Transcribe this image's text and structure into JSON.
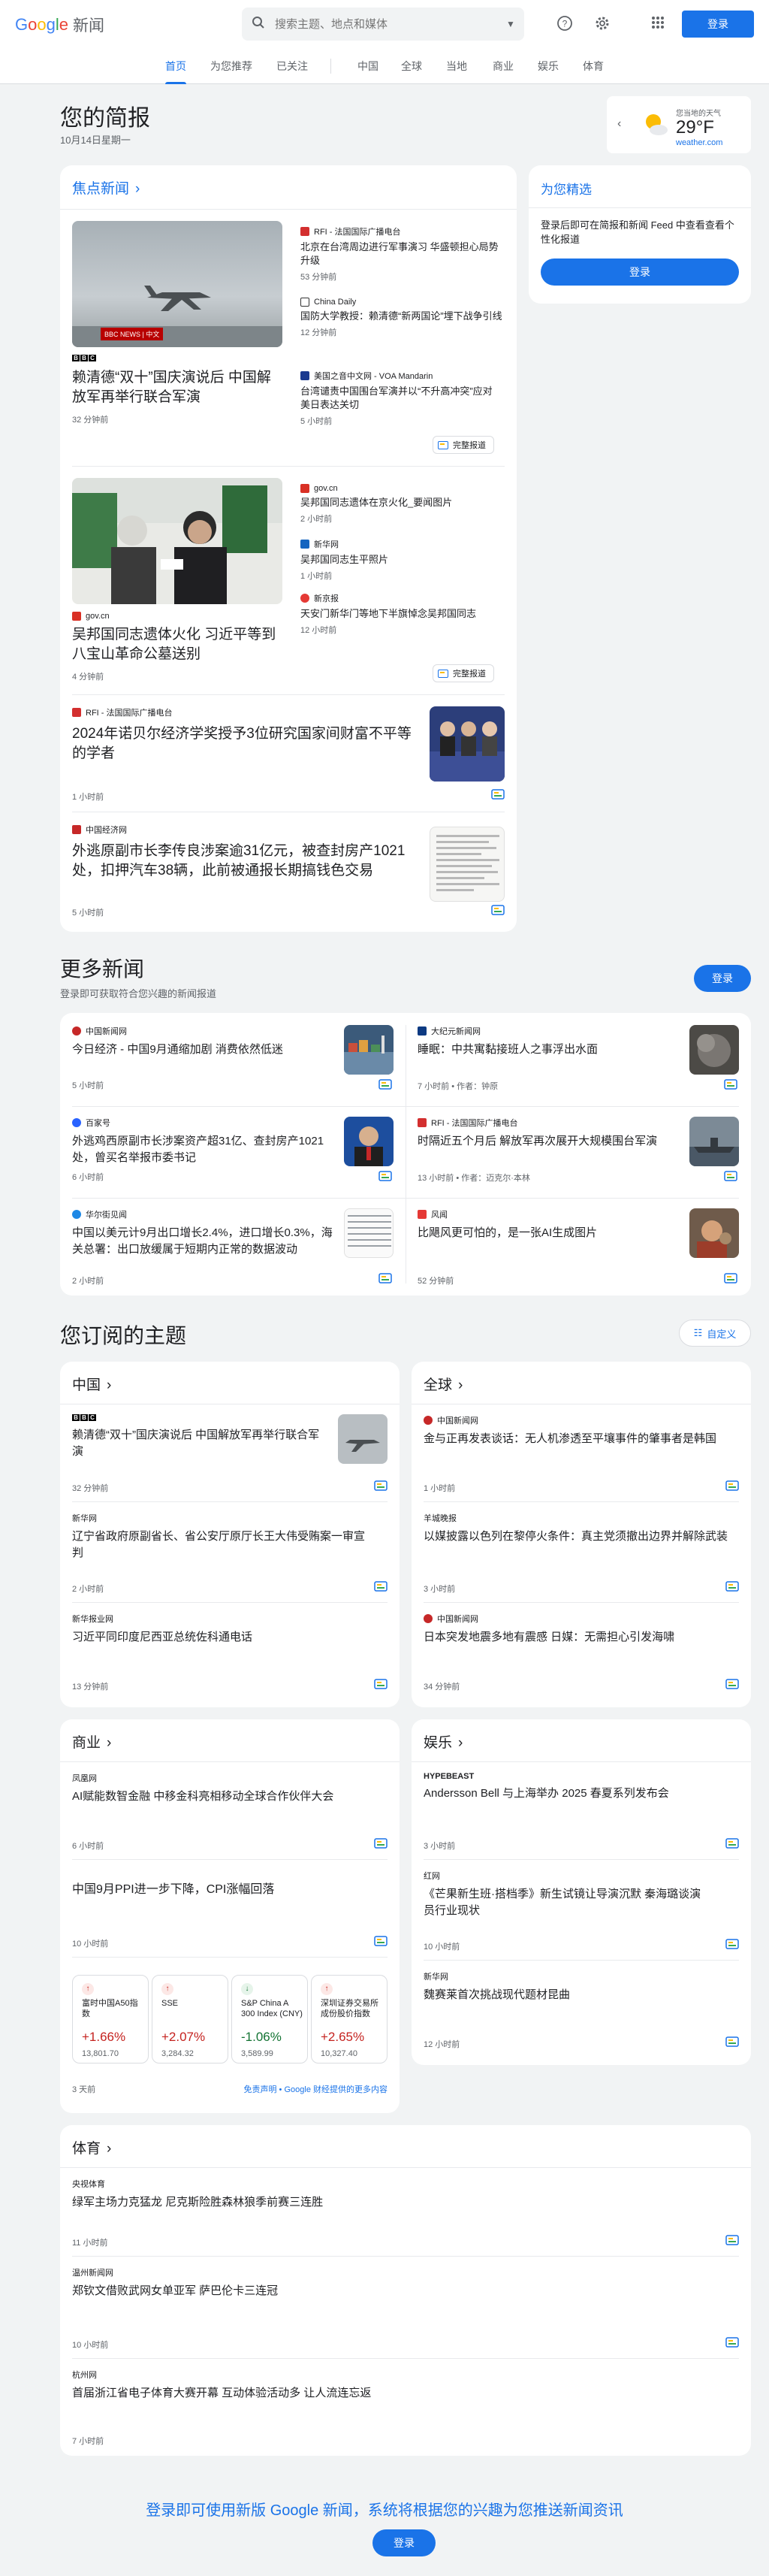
{
  "header": {
    "logo_google": [
      "G",
      "o",
      "o",
      "g",
      "l",
      "e"
    ],
    "logo_news": "新闻",
    "search_placeholder": "搜索主题、地点和媒体",
    "signin": "登录"
  },
  "nav": {
    "tabs": [
      "首页",
      "为您推荐",
      "已关注"
    ],
    "sections": [
      "中国",
      "全球",
      "当地",
      "商业",
      "娱乐",
      "体育"
    ]
  },
  "briefing": {
    "title": "您的简报",
    "date": "10月14日星期一"
  },
  "weather": {
    "location": "您当地的天气",
    "temp": "29°F",
    "source": "weather.com"
  },
  "top_stories": {
    "label": "焦点新闻",
    "cluster1": {
      "main": {
        "publisher": "BBC",
        "headline": "赖清德“双十”国庆演说后 中国解放军再举行联合军演",
        "time": "32 分钟前"
      },
      "image_tag": "BBC NEWS | 中文",
      "side": [
        {
          "publisher": "RFI - 法国国际广播电台",
          "headline": "北京在台湾周边进行军事演习 华盛顿担心局势升级",
          "time": "53 分钟前"
        },
        {
          "publisher": "China Daily",
          "headline": "国防大学教授：赖清德“新两国论”埋下战争引线",
          "time": "12 分钟前"
        },
        {
          "publisher": "美国之音中文网 - VOA Mandarin",
          "headline": "台湾谴责中国围台军演并以“不升高冲突”应对 美日表达关切",
          "time": "5 小时前"
        }
      ],
      "full_coverage": "完整报道"
    },
    "cluster2": {
      "main": {
        "publisher": "gov.cn",
        "headline": "吴邦国同志遗体火化 习近平等到八宝山革命公墓送别",
        "time": "4 分钟前"
      },
      "side": [
        {
          "publisher": "gov.cn",
          "headline": "吴邦国同志遗体在京火化_要闻图片",
          "time": "2 小时前"
        },
        {
          "publisher": "新华网",
          "headline": "吴邦国同志生平照片",
          "time": "1 小时前"
        },
        {
          "publisher": "新京报",
          "headline": "天安门新华门等地下半旗悼念吴邦国同志",
          "time": "12 小时前"
        }
      ],
      "full_coverage": "完整报道"
    },
    "story3": {
      "publisher": "RFI - 法国国际广播电台",
      "headline": "2024年诺贝尔经济学奖授予3位研究国家间财富不平等的学者",
      "time": "1 小时前"
    },
    "story4": {
      "publisher": "中国经济网",
      "headline": "外逃原副市长李传良涉案逾31亿元，被查封房产1021处，扣押汽车38辆，此前被通报长期搞钱色交易",
      "time": "5 小时前"
    }
  },
  "for_you_panel": {
    "title": "为您精选",
    "desc": "登录后即可在简报和新闻 Feed 中查看查看个性化报道",
    "button": "登录"
  },
  "more_news": {
    "title": "更多新闻",
    "subtitle": "登录即可获取符合您兴趣的新闻报道",
    "button": "登录",
    "items": [
      {
        "publisher": "中国新闻网",
        "headline": "今日经济 - 中国9月通缩加剧 消费依然低迷",
        "time": "5 小时前",
        "author": ""
      },
      {
        "publisher": "大纪元新闻网",
        "headline": "睡眠：中共寓黏接班人之事浮出水面",
        "time": "7 小时前",
        "author": "作者：钟原"
      },
      {
        "publisher": "百家号",
        "headline": "外逃鸡西原副市长涉案资产超31亿、查封房产1021处，曾买名举报市委书记",
        "time": "6 小时前",
        "author": ""
      },
      {
        "publisher": "RFI - 法国国际广播电台",
        "headline": "时隔近五个月后 解放军再次展开大规模围台军演",
        "time": "13 小时前",
        "author": "作者：迈克尔·本林"
      },
      {
        "publisher": "华尔街见闻",
        "headline": "中国以美元计9月出口增长2.4%，进口增长0.3%，海关总署：出口放缓属于短期内正常的数据波动",
        "time": "2 小时前",
        "author": ""
      },
      {
        "publisher": "风闻",
        "headline": "比飓风更可怕的，是一张AI生成图片",
        "time": "52 分钟前",
        "author": ""
      }
    ]
  },
  "topics": {
    "title": "您订阅的主题",
    "customize": "自定义",
    "china": {
      "label": "中国",
      "items": [
        {
          "publisher": "BBC",
          "headline": "赖清德“双十”国庆演说后 中国解放军再举行联合军演",
          "time": "32 分钟前"
        },
        {
          "publisher": "新华网",
          "headline": "辽宁省政府原副省长、省公安厅原厅长王大伟受贿案一审宣判",
          "time": "2 小时前"
        },
        {
          "publisher": "新华报业网",
          "headline": "习近平同印度尼西亚总统佐科通电话",
          "time": "13 分钟前"
        }
      ]
    },
    "world": {
      "label": "全球",
      "items": [
        {
          "publisher": "中国新闻网",
          "headline": "金与正再发表谈话：无人机渗透至平壤事件的肇事者是韩国",
          "time": "1 小时前"
        },
        {
          "publisher": "羊城晚报",
          "headline": "以媒披露以色列在黎停火条件：真主党须撤出边界并解除武装",
          "time": "3 小时前"
        },
        {
          "publisher": "中国新闻网",
          "headline": "日本突发地震多地有震感 日媒：无需担心引发海啸",
          "time": "34 分钟前"
        }
      ]
    },
    "business": {
      "label": "商业",
      "items": [
        {
          "publisher": "凤凰网",
          "headline": "AI赋能数智金融 中移金科亮相移动全球合作伙伴大会",
          "time": "6 小时前"
        },
        {
          "publisher": "",
          "headline": "中国9月PPI进一步下降，CPI涨幅回落",
          "time": "10 小时前"
        }
      ],
      "stocks": [
        {
          "name": "富时中国A50指数",
          "change": "+1.66%",
          "value": "13,801.70",
          "up": true
        },
        {
          "name": "SSE",
          "change": "+2.07%",
          "value": "3,284.32",
          "up": true
        },
        {
          "name": "S&P China A 300 Index (CNY)",
          "change": "-1.06%",
          "value": "3,589.99",
          "up": false
        },
        {
          "name": "深圳证券交易所成份股价指数",
          "change": "+2.65%",
          "value": "10,327.40",
          "up": true
        }
      ],
      "stocks_time": "3 天前",
      "disclaimer": "免责声明 • Google 财经提供的更多内容"
    },
    "entertainment": {
      "label": "娱乐",
      "items": [
        {
          "publisher": "HYPEBEAST",
          "headline": "Andersson Bell 与上海举办 2025 春夏系列发布会",
          "time": "3 小时前"
        },
        {
          "publisher": "红网",
          "headline": "《芒果新生班·搭档季》新生试镜让导演沉默 秦海璐谈演员行业现状",
          "time": "10 小时前"
        },
        {
          "publisher": "新华网",
          "headline": "魏赛莱首次挑战现代题材昆曲",
          "time": "12 小时前"
        }
      ]
    },
    "sports": {
      "label": "体育",
      "items": [
        {
          "publisher": "央视体育",
          "headline": "绿军主场力克猛龙 尼克斯险胜森林狼季前赛三连胜",
          "time": "11 小时前"
        },
        {
          "publisher": "温州新闻网",
          "headline": "郑钦文借败武网女单亚军 萨巴伦卡三连冠",
          "time": "10 小时前"
        },
        {
          "publisher": "杭州网",
          "headline": "首届浙江省电子体育大赛开幕 互动体验活动多 让人流连忘返",
          "time": "7 小时前"
        }
      ]
    }
  },
  "footer": {
    "title": "登录即可使用新版 Google 新闻，系统将根据您的兴趣为您推送新闻资讯",
    "button": "登录"
  },
  "colors": {
    "accent": "#1a73e8",
    "up": "#137333",
    "down": "#c5221f"
  }
}
